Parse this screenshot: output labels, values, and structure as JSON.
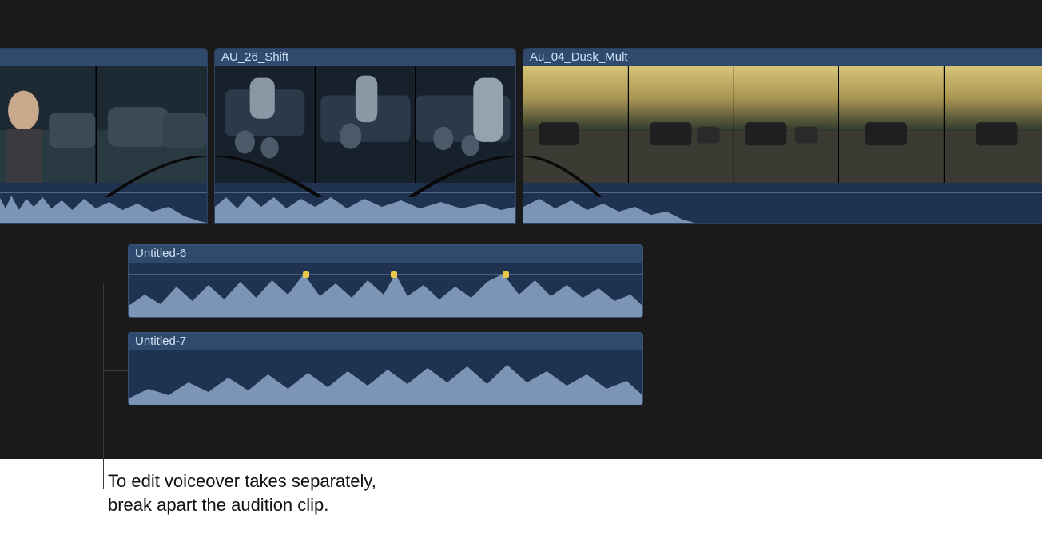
{
  "video_clips": [
    {
      "label": "",
      "thumb_style": "interview"
    },
    {
      "label": "AU_26_Shift",
      "thumb_style": "interior"
    },
    {
      "label": "Au_04_Dusk_Mult",
      "thumb_style": "dusk"
    }
  ],
  "audio_clips": [
    {
      "label": "Untitled-6",
      "peaks": [
        220,
        330,
        470
      ]
    },
    {
      "label": "Untitled-7",
      "peaks": []
    }
  ],
  "callout": {
    "text": "To edit voiceover takes separately,\nbreak apart the audition clip."
  },
  "colors": {
    "clip_header": "#2f4a6d",
    "clip_body": "#1f3350",
    "waveform": "#7c94b5",
    "timeline_bg": "#1a1a1a",
    "peak_warning": "#e7c84a"
  }
}
